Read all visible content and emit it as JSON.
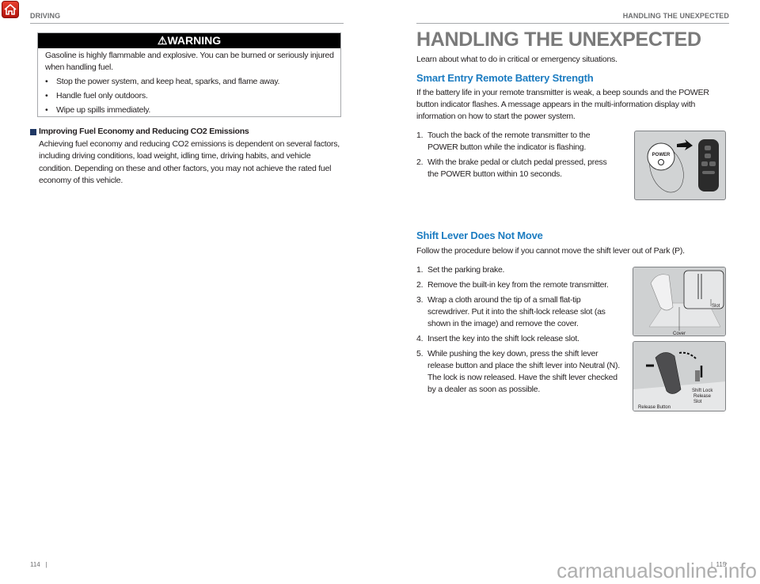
{
  "left_page": {
    "header": "DRIVING",
    "warning": {
      "title": "WARNING",
      "intro": "Gasoline is highly flammable and explosive. You can be burned or seriously injured when handling fuel.",
      "bullets": [
        "Stop the power system, and keep heat, sparks, and flame away.",
        "Handle fuel only outdoors.",
        "Wipe up spills immediately."
      ]
    },
    "section": {
      "title": "Improving Fuel Economy and Reducing CO2 Emissions",
      "body": "Achieving fuel economy and reducing CO2 emissions is dependent on several factors, including driving conditions, load weight, idling time, driving habits, and vehicle condition. Depending on these and other factors, you may not achieve the rated fuel economy of this vehicle."
    },
    "page_number": "114"
  },
  "right_page": {
    "header": "HANDLING THE UNEXPECTED",
    "title": "HANDLING THE UNEXPECTED",
    "intro": "Learn about what to do in critical or emergency situations.",
    "battery": {
      "title": "Smart Entry Remote Battery Strength",
      "body": "If the battery life in your remote transmitter is weak, a beep sounds and the POWER button indicator flashes. A message appears in the multi-information display with information on how to start the power system.",
      "steps": [
        {
          "n": "1.",
          "text": "Touch the back of the remote transmitter to the POWER button while the indicator is flashing."
        },
        {
          "n": "2.",
          "text": "With the brake pedal or clutch pedal pressed, press the POWER button within 10 seconds."
        }
      ],
      "image_label": "POWER"
    },
    "shift": {
      "title": "Shift Lever Does Not Move",
      "body": "Follow the procedure below if you cannot move the shift lever out of Park (P).",
      "steps": [
        {
          "n": "1.",
          "text": "Set the parking brake."
        },
        {
          "n": "2.",
          "text": "Remove the built-in key from the remote transmitter."
        },
        {
          "n": "3.",
          "text": "Wrap a cloth around the tip of a small flat-tip screwdriver. Put it into the shift-lock release slot (as shown in the image) and remove the cover."
        },
        {
          "n": "4.",
          "text": "Insert the key into the shift lock release slot."
        },
        {
          "n": "5.",
          "text": "While pushing the key down, press the shift lever release button and place the shift lever into Neutral (N). The lock is now released. Have the shift lever checked by a dealer as soon as possible."
        }
      ],
      "image1_labels": {
        "slot": "Slot",
        "cover": "Cover"
      },
      "image2_labels": {
        "release_button": "Release Button",
        "shift_lock_1": "Shift Lock",
        "shift_lock_2": "Release",
        "shift_lock_3": "Slot"
      }
    },
    "page_number": "115"
  },
  "watermark": "carmanualsonline.info",
  "colors": {
    "accent_blue": "#1c7cc1",
    "title_gray": "#7a7a7a",
    "home_red": "#d4271b"
  }
}
